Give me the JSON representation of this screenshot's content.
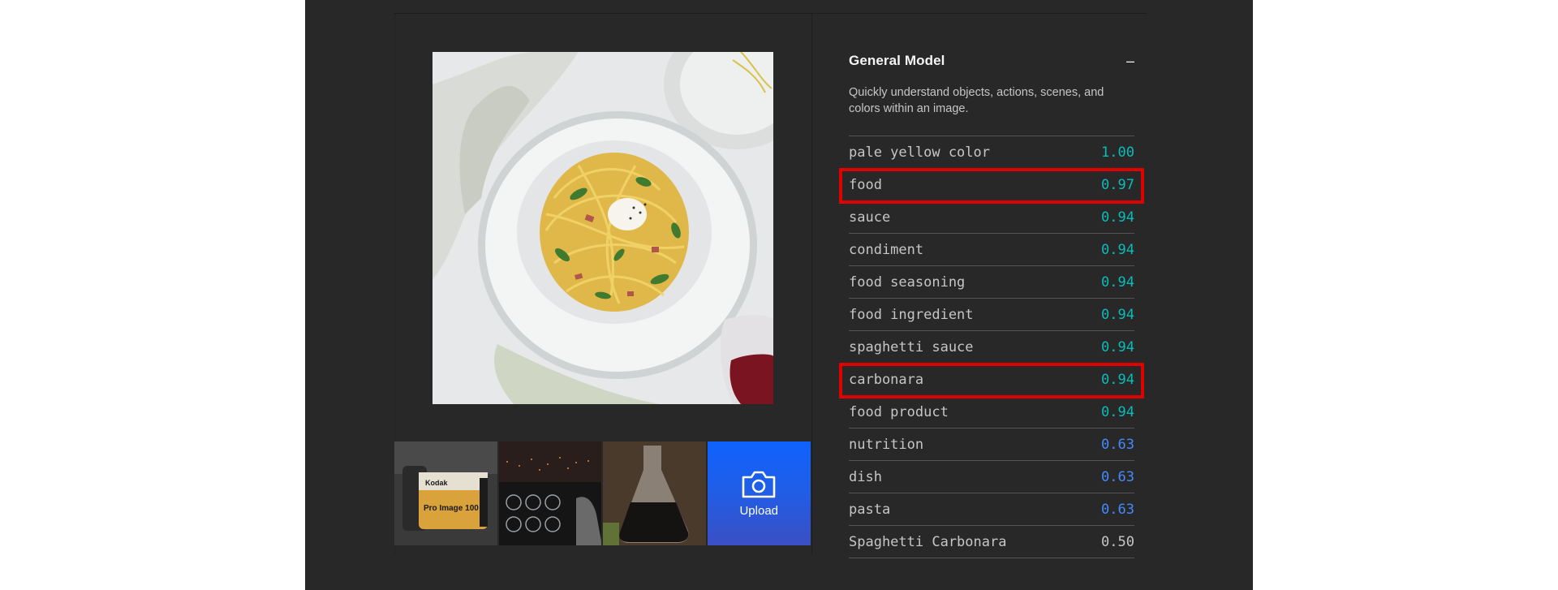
{
  "colors": {
    "background": "#282828",
    "accent_blue": "#0f62fe",
    "score_teal": "#08bdba",
    "score_blue": "#4589ff",
    "score_gray": "#c6c6c6",
    "highlight_red": "#e00000"
  },
  "main_image": {
    "icon": "pasta-carbonara-photo"
  },
  "thumbnails": [
    {
      "icon": "film-canister-photo",
      "label": "Kodak",
      "sublabel": "Pro Image 100"
    },
    {
      "icon": "cockpit-photo"
    },
    {
      "icon": "beaker-photo"
    }
  ],
  "upload": {
    "label": "Upload",
    "icon": "camera-icon"
  },
  "model": {
    "title": "General Model",
    "collapse_symbol": "–",
    "description": "Quickly understand objects, actions, scenes, and colors within an image."
  },
  "results": [
    {
      "label": "pale yellow color",
      "score": "1.00",
      "tier": "teal",
      "highlighted": false
    },
    {
      "label": "food",
      "score": "0.97",
      "tier": "teal",
      "highlighted": true
    },
    {
      "label": "sauce",
      "score": "0.94",
      "tier": "teal",
      "highlighted": false
    },
    {
      "label": "condiment",
      "score": "0.94",
      "tier": "teal",
      "highlighted": false
    },
    {
      "label": "food seasoning",
      "score": "0.94",
      "tier": "teal",
      "highlighted": false
    },
    {
      "label": "food ingredient",
      "score": "0.94",
      "tier": "teal",
      "highlighted": false
    },
    {
      "label": "spaghetti sauce",
      "score": "0.94",
      "tier": "teal",
      "highlighted": false
    },
    {
      "label": "carbonara",
      "score": "0.94",
      "tier": "teal",
      "highlighted": true
    },
    {
      "label": "food product",
      "score": "0.94",
      "tier": "teal",
      "highlighted": false
    },
    {
      "label": "nutrition",
      "score": "0.63",
      "tier": "blue",
      "highlighted": false
    },
    {
      "label": "dish",
      "score": "0.63",
      "tier": "blue",
      "highlighted": false
    },
    {
      "label": "pasta",
      "score": "0.63",
      "tier": "blue",
      "highlighted": false
    },
    {
      "label": "Spaghetti Carbonara",
      "score": "0.50",
      "tier": "gray",
      "highlighted": false
    }
  ]
}
